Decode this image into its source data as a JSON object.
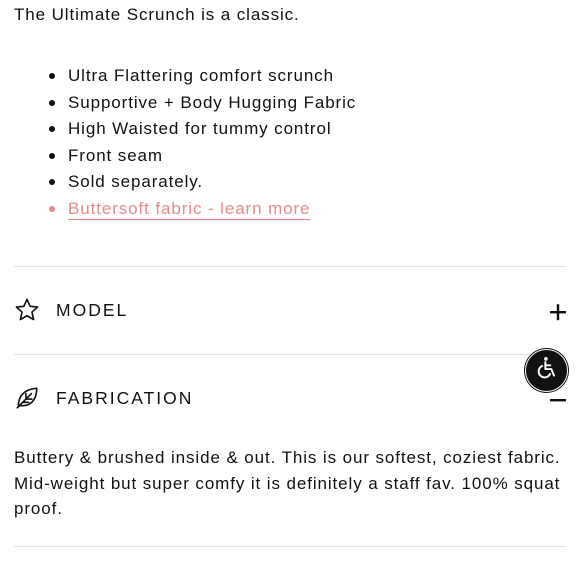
{
  "intro": "The Ultimate Scrunch is a classic.",
  "features": [
    "Ultra Flattering comfort scrunch",
    "Supportive + Body Hugging Fabric",
    "High Waisted for tummy control",
    "Front seam",
    "Sold separately."
  ],
  "fabric_link": "Buttersoft fabric - learn more",
  "accordion": {
    "model": {
      "label": "MODEL",
      "icon": "star-outline-icon",
      "state": "collapsed",
      "toggle_icon": "plus-icon"
    },
    "fabrication": {
      "label": "FABRICATION",
      "icon": "leaf-outline-icon",
      "state": "expanded",
      "toggle_icon": "minus-icon",
      "body": "Buttery & brushed inside & out. This is our softest, coziest fabric. Mid-weight but super comfy it is definitely a staff fav. 100% squat proof."
    }
  },
  "accessibility_button": {
    "icon": "wheelchair-icon"
  },
  "colors": {
    "text": "#111111",
    "link": "#e58a8c",
    "divider": "#e2e2e2",
    "a11y_bg": "#111111"
  }
}
